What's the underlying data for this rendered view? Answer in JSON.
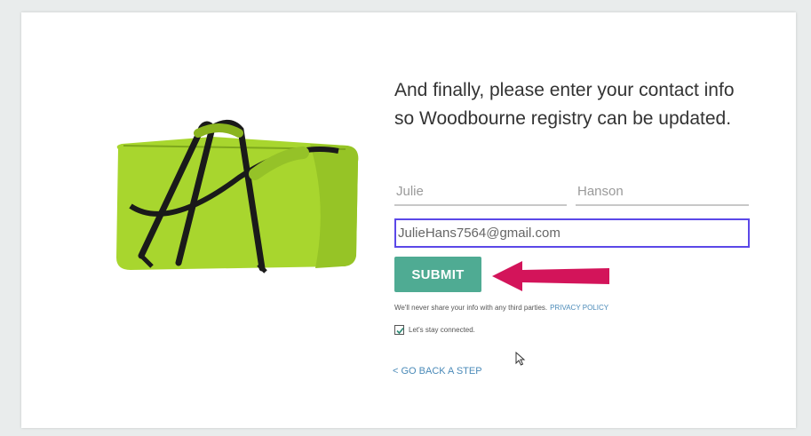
{
  "form": {
    "heading": "And finally, please enter your contact info so Woodbourne registry can be updated.",
    "first_name_value": "Julie",
    "last_name_value": "Hanson",
    "email_value": "JulieHans7564@gmail.com",
    "submit_label": "SUBMIT",
    "privacy_note": "We'll never share your info with any third parties.",
    "privacy_link": "PRIVACY POLICY",
    "consent_label": "Let's stay connected.",
    "consent_checked": true,
    "back_link": "< GO BACK A STEP"
  },
  "product": {
    "image_icon": "duffel-bag-image",
    "bag_color": "#a8d62e"
  },
  "annotation": {
    "icon": "arrow-left-icon",
    "color": "#d3145a"
  },
  "colors": {
    "submit_bg": "#4fab93",
    "email_focus_border": "#5b48e8",
    "link": "#4a8ab8"
  }
}
